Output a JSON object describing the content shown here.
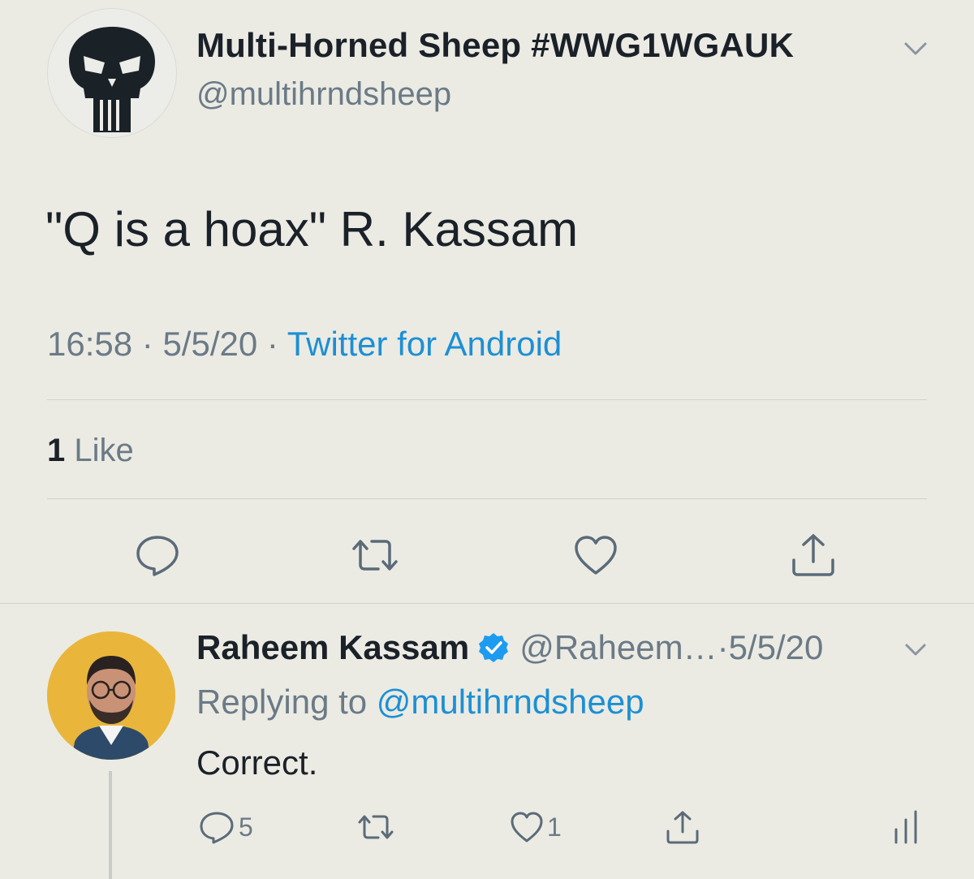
{
  "tweet": {
    "author_name": "Multi-Horned Sheep #WWG1WGAUK",
    "author_handle": "@multihrndsheep",
    "text": "\"Q is a hoax\" R. Kassam",
    "time": "16:58",
    "date": "5/5/20",
    "separator": " · ",
    "source": "Twitter for Android",
    "likes_count": "1",
    "likes_label": " Like",
    "avatar_icon": "punisher-skull-icon",
    "actions": [
      "reply-icon",
      "retweet-icon",
      "like-icon",
      "share-icon"
    ]
  },
  "reply": {
    "author_name": "Raheem Kassam",
    "author_handle": "@Raheem…",
    "date_sep": " · ",
    "date": "5/5/20",
    "replying_prefix": "Replying to ",
    "replying_to": "@multihrndsheep",
    "text": "Correct.",
    "reply_count": "5",
    "like_count": "1",
    "verified": true,
    "avatar_icon": "person-avatar"
  },
  "colors": {
    "background": "#ebebe4",
    "link": "#1d8fd4",
    "muted": "#6b7a86",
    "text": "#1b2128",
    "verified": "#1d9bf0",
    "reply_avatar_bg": "#e9b63b"
  }
}
